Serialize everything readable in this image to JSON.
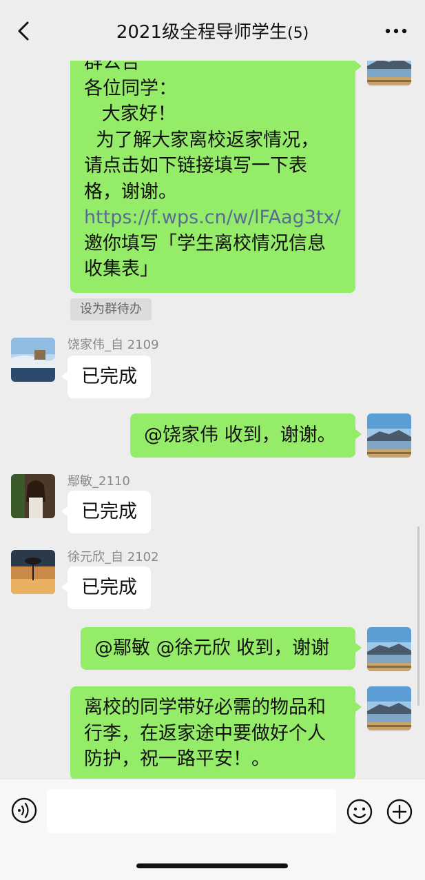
{
  "header": {
    "title": "2021级全程导师学生",
    "member_count": "(5)"
  },
  "messages": [
    {
      "side": "right",
      "lines": [
        "群公告",
        "各位同学：",
        "   大家好！",
        "  为了解大家离校返家情况，",
        "请点击如下链接填写一下表",
        "格，谢谢。"
      ],
      "link": "https://f.wps.cn/w/lFAag3tx/",
      "lines_after": [
        "邀你填写「学生离校情况信息",
        "收集表」"
      ]
    },
    {
      "action": "设为群待办"
    },
    {
      "side": "left",
      "sender": "饶家伟_自 2109",
      "text": "已完成"
    },
    {
      "side": "right",
      "text": "@饶家伟 收到，谢谢。"
    },
    {
      "side": "left",
      "sender": "鄢敏_2110",
      "text": "已完成"
    },
    {
      "side": "left",
      "sender": "徐元欣_自 2102",
      "text": "已完成"
    },
    {
      "side": "right",
      "text": "@鄢敏 @徐元欣 收到，谢谢"
    },
    {
      "side": "right",
      "lines": [
        "离校的同学带好必需的物品和",
        "行李，在返家途中要做好个人",
        "防护，祝一路平安！。"
      ]
    }
  ],
  "icons": {
    "back": "back-chevron-icon",
    "more": "more-dots-icon",
    "voice": "voice-input-icon",
    "emoji": "emoji-icon",
    "plus": "plus-icon"
  },
  "colors": {
    "background": "#ededed",
    "bubble_self": "#95ec69",
    "bubble_other": "#ffffff",
    "link": "#576b95"
  }
}
